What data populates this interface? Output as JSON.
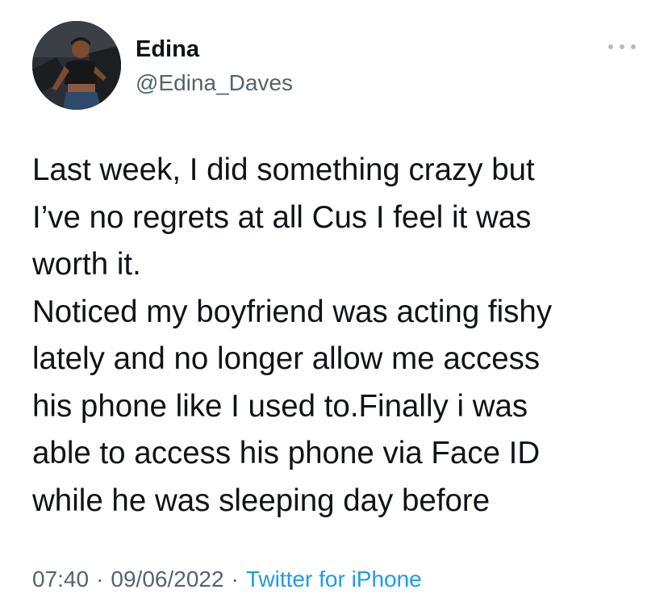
{
  "author": {
    "name": "Edina",
    "handle": "@Edina_Daves",
    "avatar_icon": "profile-photo"
  },
  "more_menu": {
    "icon": "more-horizontal-icon"
  },
  "tweet": {
    "lines": [
      "Last week, I did something crazy but",
      "I’ve no regrets at all Cus I feel it was",
      "worth it.",
      "Noticed my boyfriend was acting fishy",
      "lately and no longer allow me access",
      "his phone like I used to.Finally i was",
      "able to access his phone via Face ID",
      "while he was sleeping day before"
    ]
  },
  "meta": {
    "time": "07:40",
    "separator": "·",
    "date": "09/06/2022",
    "source": "Twitter for iPhone"
  },
  "colors": {
    "text_primary": "#0f1419",
    "text_secondary": "#536471",
    "link": "#1d9bf0",
    "dots": "#b4bcc2"
  }
}
